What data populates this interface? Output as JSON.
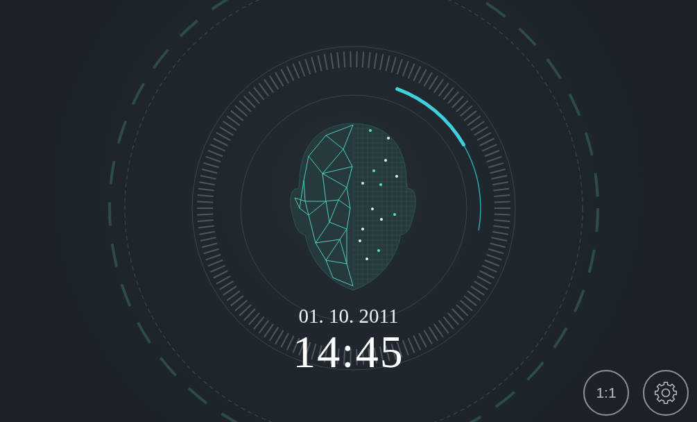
{
  "date": "01. 10. 2011",
  "time": "14:45",
  "buttons": [
    {
      "kind": "text",
      "label": "1:1"
    },
    {
      "kind": "settings"
    }
  ]
}
